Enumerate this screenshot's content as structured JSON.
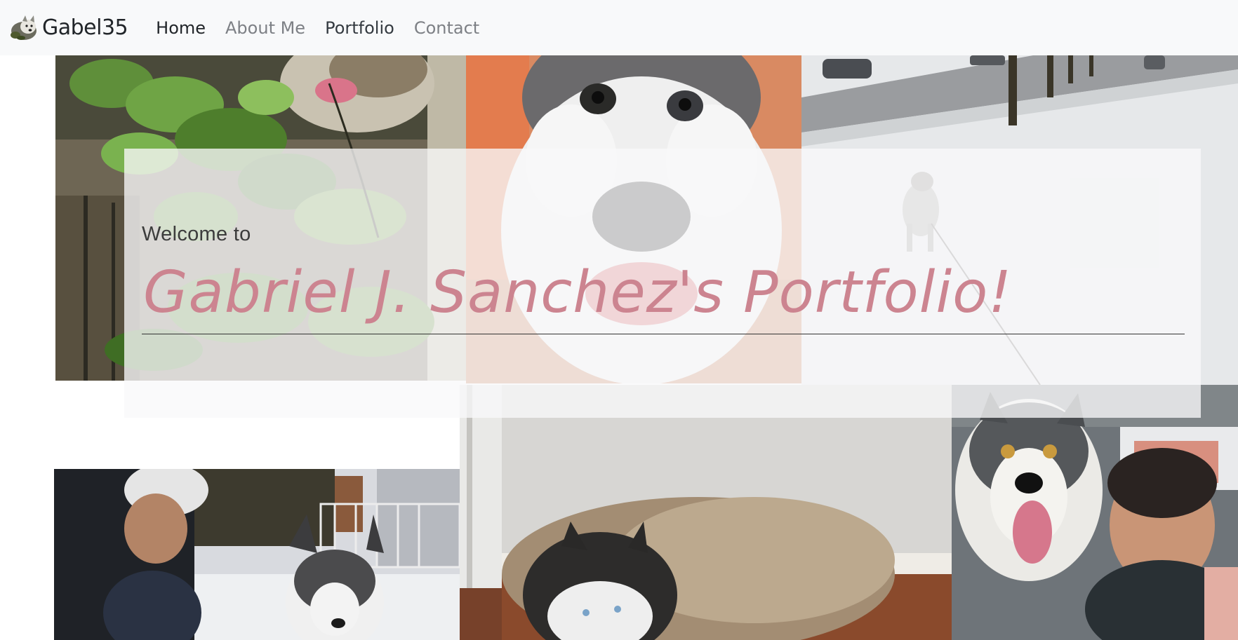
{
  "navbar": {
    "brand": "Gabel35",
    "items": [
      {
        "label": "Home",
        "state": "active"
      },
      {
        "label": "About Me",
        "state": "muted"
      },
      {
        "label": "Portfolio",
        "state": "dark"
      },
      {
        "label": "Contact",
        "state": "muted"
      }
    ]
  },
  "jumbotron": {
    "welcome": "Welcome to",
    "headline": "Gabriel J. Sanchez's Portfolio!"
  },
  "colors": {
    "navbar_bg": "#f8f9fa",
    "headline": "#cc8490",
    "jumbotron_bg": "rgba(248,249,250,0.78)"
  },
  "photos": [
    {
      "name": "husky-in-vines-photo"
    },
    {
      "name": "husky-closeup-photo"
    },
    {
      "name": "husky-in-snow-street-photo"
    },
    {
      "name": "man-with-husky-in-snow-photo"
    },
    {
      "name": "husky-lying-on-floor-photo"
    },
    {
      "name": "husky-and-man-in-car-photo"
    }
  ]
}
